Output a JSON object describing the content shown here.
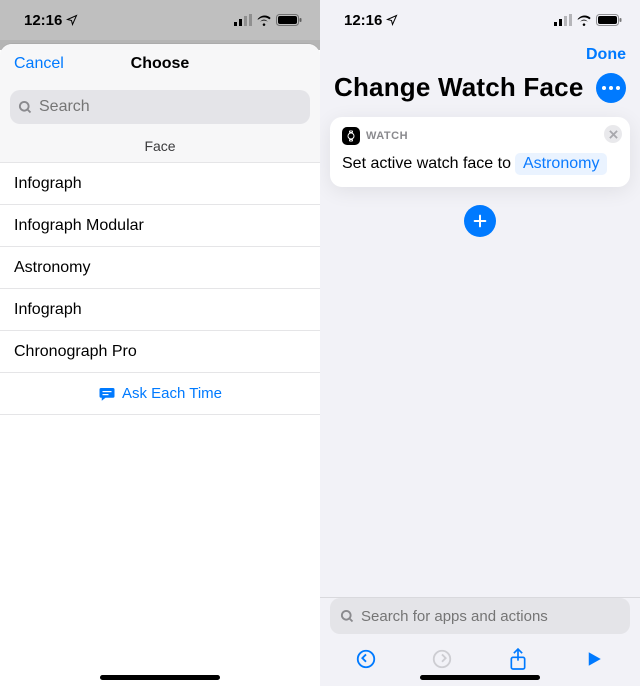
{
  "status": {
    "time": "12:16"
  },
  "left": {
    "cancel": "Cancel",
    "title": "Choose",
    "search_placeholder": "Search",
    "section": "Face",
    "rows": [
      "Infograph",
      "Infograph Modular",
      "Astronomy",
      "Infograph",
      "Chronograph Pro"
    ],
    "ask": "Ask Each Time"
  },
  "right": {
    "done": "Done",
    "title": "Change Watch Face",
    "card_app": "WATCH",
    "card_text": "Set active watch face to",
    "card_token": "Astronomy",
    "bottom_search_placeholder": "Search for apps and actions"
  }
}
